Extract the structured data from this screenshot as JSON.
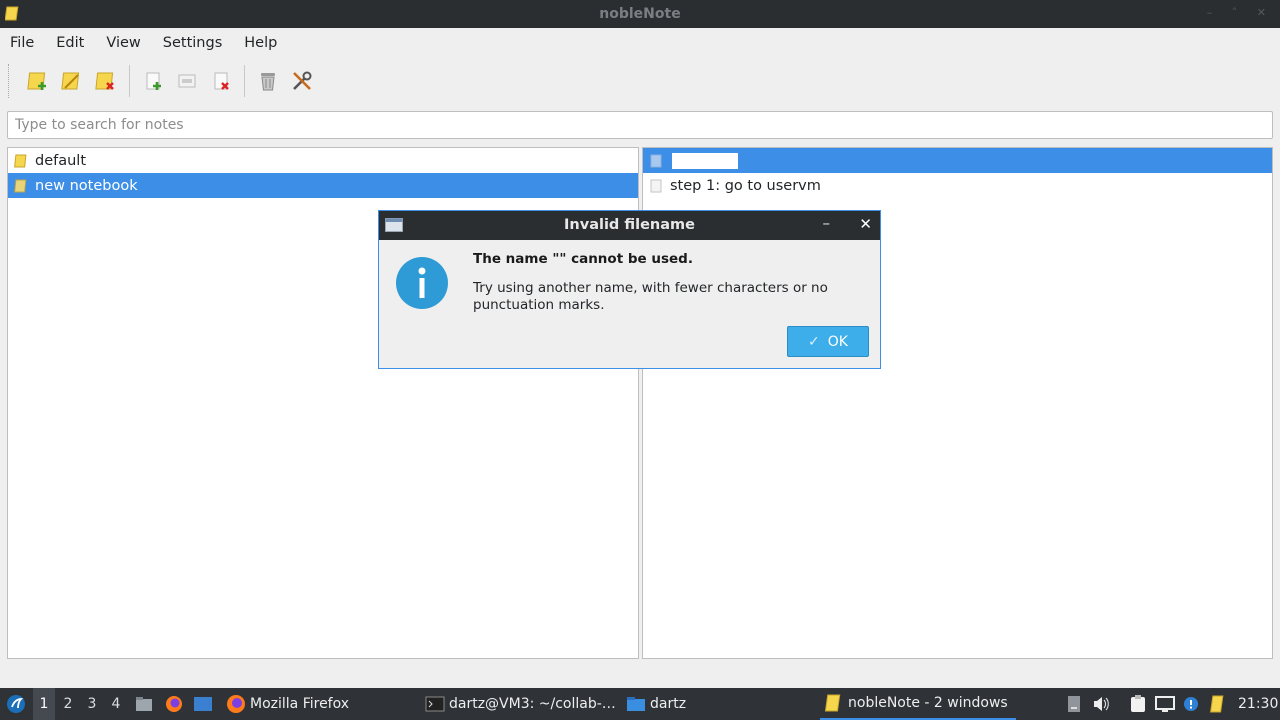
{
  "window": {
    "title": "nobleNote"
  },
  "menu": [
    "File",
    "Edit",
    "View",
    "Settings",
    "Help"
  ],
  "toolbar": {
    "buttons": [
      "new-notebook-icon",
      "rename-notebook-icon",
      "delete-notebook-icon",
      "new-note-icon",
      "rename-note-icon",
      "delete-note-icon",
      "trash-icon",
      "settings-tools-icon"
    ]
  },
  "search": {
    "placeholder": "Type to search for notes"
  },
  "notebooks": [
    {
      "label": "default",
      "selected": false
    },
    {
      "label": "new notebook",
      "selected": true
    }
  ],
  "notes": [
    {
      "label": "",
      "editing": true,
      "selected": true
    },
    {
      "label": "step 1: go to uservm",
      "selected": false
    }
  ],
  "dialog": {
    "title": "Invalid filename",
    "heading": "The name \"\" cannot be used.",
    "detail": "Try using another name, with fewer characters or no punctuation marks.",
    "ok_label": "OK",
    "minimize_glyph": "–",
    "close_glyph": "✕"
  },
  "taskbar": {
    "workspaces": [
      "1",
      "2",
      "3",
      "4"
    ],
    "active_workspace": "1",
    "tasks": [
      {
        "label": "Mozilla Firefox",
        "icon": "firefox-icon"
      },
      {
        "label": "dartz@VM3: ~/collab-…",
        "icon": "terminal-icon"
      },
      {
        "label": "dartz",
        "icon": "folder-icon"
      },
      {
        "label": "nobleNote - 2 windows",
        "icon": "notebook-icon",
        "active": true
      }
    ],
    "clock": "21:30"
  },
  "colors": {
    "accent": "#3d8ee6",
    "ok_button": "#3daee9",
    "titlebar": "#2b2e31",
    "taskbar": "#2f3338"
  }
}
